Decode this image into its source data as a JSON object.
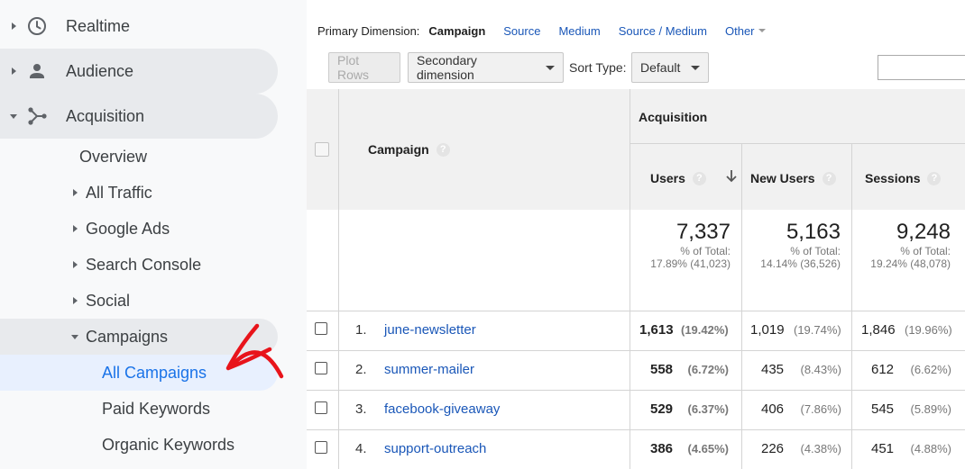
{
  "sidebar": {
    "top_items": [
      {
        "label": "Realtime"
      },
      {
        "label": "Audience"
      },
      {
        "label": "Acquisition"
      }
    ],
    "sub_items": [
      {
        "label": "Overview"
      },
      {
        "label": "All Traffic"
      },
      {
        "label": "Google Ads"
      },
      {
        "label": "Search Console"
      },
      {
        "label": "Social"
      },
      {
        "label": "Campaigns"
      },
      {
        "label": "All Campaigns"
      },
      {
        "label": "Paid Keywords"
      },
      {
        "label": "Organic Keywords"
      }
    ]
  },
  "dimensions": {
    "label": "Primary Dimension:",
    "current": "Campaign",
    "links": [
      "Source",
      "Medium",
      "Source / Medium"
    ],
    "other": "Other"
  },
  "toolbar": {
    "plot_rows": "Plot Rows",
    "secondary_dimension": "Secondary dimension",
    "sort_type_label": "Sort Type:",
    "sort_type_value": "Default",
    "search_value": ""
  },
  "table": {
    "dimension_header": "Campaign",
    "group_header": "Acquisition",
    "columns": [
      "Users",
      "New Users",
      "Sessions"
    ],
    "totals": [
      {
        "value": "7,337",
        "label": "% of Total:",
        "detail": "17.89% (41,023)"
      },
      {
        "value": "5,163",
        "label": "% of Total:",
        "detail": "14.14% (36,526)"
      },
      {
        "value": "9,248",
        "label": "% of Total:",
        "detail": "19.24% (48,078)"
      }
    ],
    "rows": [
      {
        "num": "1.",
        "campaign": "june-newsletter",
        "users": "1,613",
        "users_pct": "(19.42%)",
        "new_users": "1,019",
        "new_users_pct": "(19.74%)",
        "sessions": "1,846",
        "sessions_pct": "(19.96%)"
      },
      {
        "num": "2.",
        "campaign": "summer-mailer",
        "users": "558",
        "users_pct": "(6.72%)",
        "new_users": "435",
        "new_users_pct": "(8.43%)",
        "sessions": "612",
        "sessions_pct": "(6.62%)"
      },
      {
        "num": "3.",
        "campaign": "facebook-giveaway",
        "users": "529",
        "users_pct": "(6.37%)",
        "new_users": "406",
        "new_users_pct": "(7.86%)",
        "sessions": "545",
        "sessions_pct": "(5.89%)"
      },
      {
        "num": "4.",
        "campaign": "support-outreach",
        "users": "386",
        "users_pct": "(4.65%)",
        "new_users": "226",
        "new_users_pct": "(4.38%)",
        "sessions": "451",
        "sessions_pct": "(4.88%)"
      }
    ]
  },
  "colors": {
    "link": "#1a57b8",
    "active_nav": "#1a73e8",
    "annotation_arrow": "#e8141b"
  }
}
